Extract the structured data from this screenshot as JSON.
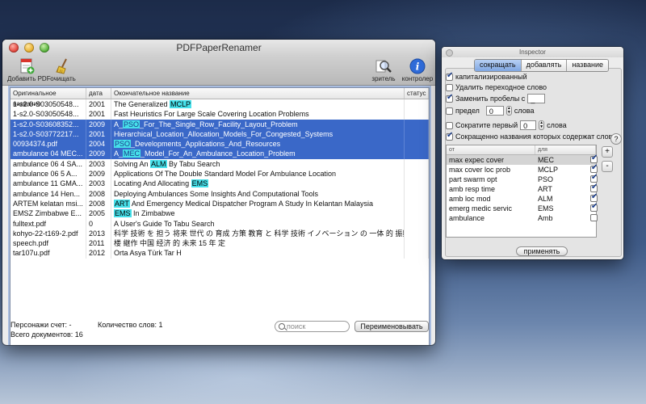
{
  "main": {
    "title": "PDFPaperRenamer",
    "toolbar": {
      "add_pdf": "Добавить PDF",
      "clear": "очищать",
      "viewer": "зритель",
      "inspector": "контролер"
    },
    "columns": [
      "Оригинальное название",
      "дата",
      "Окончательное название",
      "статус"
    ],
    "rows": [
      {
        "orig": "1-s2.0-S03050548...",
        "date": "2001",
        "pre": "The Generalized ",
        "hl": "MCLP",
        "post": "",
        "sel": false
      },
      {
        "orig": "1-s2.0-S03050548...",
        "date": "2001",
        "pre": "Fast Heuristics For Large Scale Covering Location Problems",
        "hl": "",
        "post": "",
        "sel": false
      },
      {
        "orig": "1-s2.0-S03608352...",
        "date": "2009",
        "pre": "A_",
        "hl": "PSO",
        "post": "_For_The_Single_Row_Facility_Layout_Problem",
        "sel": true
      },
      {
        "orig": "1-s2.0-S03772217...",
        "date": "2001",
        "pre": "Hierarchical_Location_Allocation_Models_For_Congested_Systems",
        "hl": "",
        "post": "",
        "sel": true
      },
      {
        "orig": "00934374.pdf",
        "date": "2004",
        "pre": "",
        "hl": "PSO",
        "post": "_Developments_Applications_And_Resources",
        "sel": true
      },
      {
        "orig": "ambulance 04 MEC...",
        "date": "2009",
        "pre": "A_",
        "hl": "MEC",
        "post": "_Model_For_An_Ambulance_Location_Problem",
        "sel": true
      },
      {
        "orig": "ambulance 06 4 SA...",
        "date": "2003",
        "pre": "Solving An ",
        "hl": "ALM",
        "post": " By Tabu Search",
        "sel": false
      },
      {
        "orig": "ambulance 06 5 A...",
        "date": "2009",
        "pre": "Applications Of The Double Standard Model For Ambulance Location",
        "hl": "",
        "post": "",
        "sel": false
      },
      {
        "orig": "ambulance 11 GMA...",
        "date": "2003",
        "pre": "Locating And Allocating ",
        "hl": "EMS",
        "post": "",
        "sel": false
      },
      {
        "orig": "ambulance 14 Hen...",
        "date": "2008",
        "pre": "Deploying Ambulances Some Insights And Computational Tools",
        "hl": "",
        "post": "",
        "sel": false
      },
      {
        "orig": "ARTEM kelatan msi...",
        "date": "2008",
        "pre": "",
        "hl": "ART",
        "post": " And Emergency Medical Dispatcher Program A Study In Kelantan Malaysia",
        "sel": false
      },
      {
        "orig": "EMSZ Zimbabwe E...",
        "date": "2005",
        "pre": "",
        "hl": "EMS",
        "post": " In Zimbabwe",
        "sel": false
      },
      {
        "orig": "fulltext.pdf",
        "date": "0",
        "pre": "A User's Guide To Tabu Search",
        "hl": "",
        "post": "",
        "sel": false
      },
      {
        "orig": "kohyo-22-t169-2.pdf",
        "date": "2013",
        "pre": "科学 技術 を 担う 将来 世代 の 育成 方策 教育 と 科学 技術 イノベーション の 一体 的 振興 の",
        "hl": "",
        "post": "",
        "sel": false
      },
      {
        "orig": "speech.pdf",
        "date": "2011",
        "pre": "楼 継作 中国 经济 的 未来 15 年 定",
        "hl": "",
        "post": "",
        "sel": false
      },
      {
        "orig": "tar107u.pdf",
        "date": "2012",
        "pre": "Orta Asya Türk Tar H",
        "hl": "",
        "post": "",
        "sel": false
      }
    ],
    "status": {
      "char_count_label": "Персонажи счет:",
      "char_count_value": "-",
      "word_count_label": "Количество слов:",
      "word_count_value": "1",
      "doc_count_label": "Всего документов:",
      "doc_count_value": "16"
    },
    "search_placeholder": "поиск",
    "rename_button": "Переименовывать"
  },
  "inspector": {
    "title": "Inspector",
    "tabs": [
      "сокращать",
      "добавлять",
      "название"
    ],
    "active_tab": 0,
    "options": {
      "capitalized": "капитализированный",
      "remove_transitional": "Удалить переходное слово",
      "replace_spaces": "Заменить пробелы с",
      "replace_value": "_",
      "limit": "предел",
      "limit_value": "0",
      "limit_unit": "слова",
      "shorten_first": "Сократите первый",
      "shorten_value": "0",
      "shorten_unit": "слова",
      "shorten_names": "Сокращенно названия которых содержат слова:"
    },
    "help": "?",
    "columns": [
      "от",
      "для"
    ],
    "abbrevs": [
      {
        "from": "max expec cover",
        "to": "MEC",
        "on": true
      },
      {
        "from": "max cover loc prob",
        "to": "MCLP",
        "on": true
      },
      {
        "from": "part swarm opt",
        "to": "PSO",
        "on": true
      },
      {
        "from": "amb resp time",
        "to": "ART",
        "on": true
      },
      {
        "from": "amb loc mod",
        "to": "ALM",
        "on": true
      },
      {
        "from": "emerg medic servic",
        "to": "EMS",
        "on": true
      },
      {
        "from": "ambulance",
        "to": "Amb",
        "on": false
      }
    ],
    "plus": "+",
    "minus": "-",
    "apply_button": "применять"
  },
  "colors": {
    "selection": "#3a68c8",
    "highlight": "#46e0ea",
    "focus_ring": "#a9bde0"
  }
}
